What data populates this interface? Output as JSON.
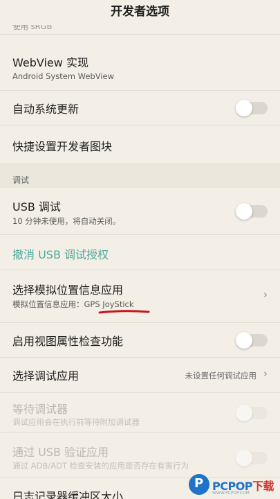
{
  "header": {
    "title": "开发者选项"
  },
  "rows": {
    "srgb_sub": "使用 sRGB",
    "webview": {
      "title": "WebView 实现",
      "sub": "Android System WebView"
    },
    "auto_update": {
      "title": "自动系统更新",
      "on": false
    },
    "quick_tiles": {
      "title": "快捷设置开发者图块"
    },
    "debug_section": {
      "label": "调试"
    },
    "usb_debug": {
      "title": "USB 调试",
      "sub": "10 分钟未使用，将自动关闭。",
      "on": false
    },
    "revoke": {
      "title": "撤消 USB 调试授权"
    },
    "mock_location": {
      "title": "选择模拟位置信息应用",
      "sub": "模拟位置信息应用：GPS JoyStick"
    },
    "view_attr": {
      "title": "启用视图属性检查功能",
      "on": false
    },
    "debug_app": {
      "title": "选择调试应用",
      "value": "未设置任何调试应用"
    },
    "wait_debugger": {
      "title": "等待调试器",
      "sub": "调试应用会在执行前等待附加调试器",
      "on": false,
      "disabled": true
    },
    "verify_usb": {
      "title": "通过 USB 验证应用",
      "sub": "通过 ADB/ADT 检查安装的应用是否存在有害行为",
      "on": false,
      "disabled": true
    },
    "logger_partial": {
      "title": "日志记录器缓冲区大小"
    }
  },
  "chevron": "›",
  "watermark": {
    "brand": "PCPOP",
    "suffix": "下载",
    "tiny": "WWW.PCPOP.COM"
  },
  "colors": {
    "background": "#f3efe6",
    "link": "#4fa89a",
    "annotation": "#c8161d",
    "watermark": "#1f73c9"
  }
}
